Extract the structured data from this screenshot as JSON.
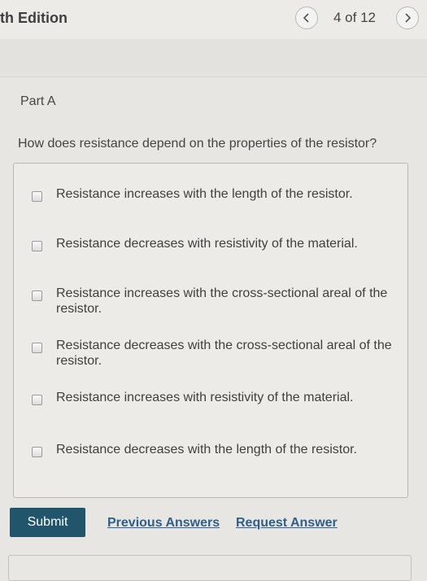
{
  "header": {
    "title": "th Edition",
    "page_counter": "4 of 12"
  },
  "part": {
    "title": "Part A",
    "question": "How does resistance depend on the properties of the resistor?"
  },
  "options": [
    {
      "label": "Resistance increases with the length of the resistor.",
      "checked": false
    },
    {
      "label": "Resistance decreases with resistivity of the material.",
      "checked": false
    },
    {
      "label": "Resistance increases with the cross-sectional areal of the resistor.",
      "checked": false
    },
    {
      "label": "Resistance decreases with the cross-sectional areal of the resistor.",
      "checked": false
    },
    {
      "label": "Resistance increases with resistivity of the material.",
      "checked": false
    },
    {
      "label": "Resistance decreases with the length of the resistor.",
      "checked": false
    }
  ],
  "actions": {
    "submit_label": "Submit",
    "previous_answers_label": "Previous Answers",
    "request_answer_label": "Request Answer"
  },
  "colors": {
    "submit_bg": "#21556b",
    "link": "#2f5f8a"
  }
}
